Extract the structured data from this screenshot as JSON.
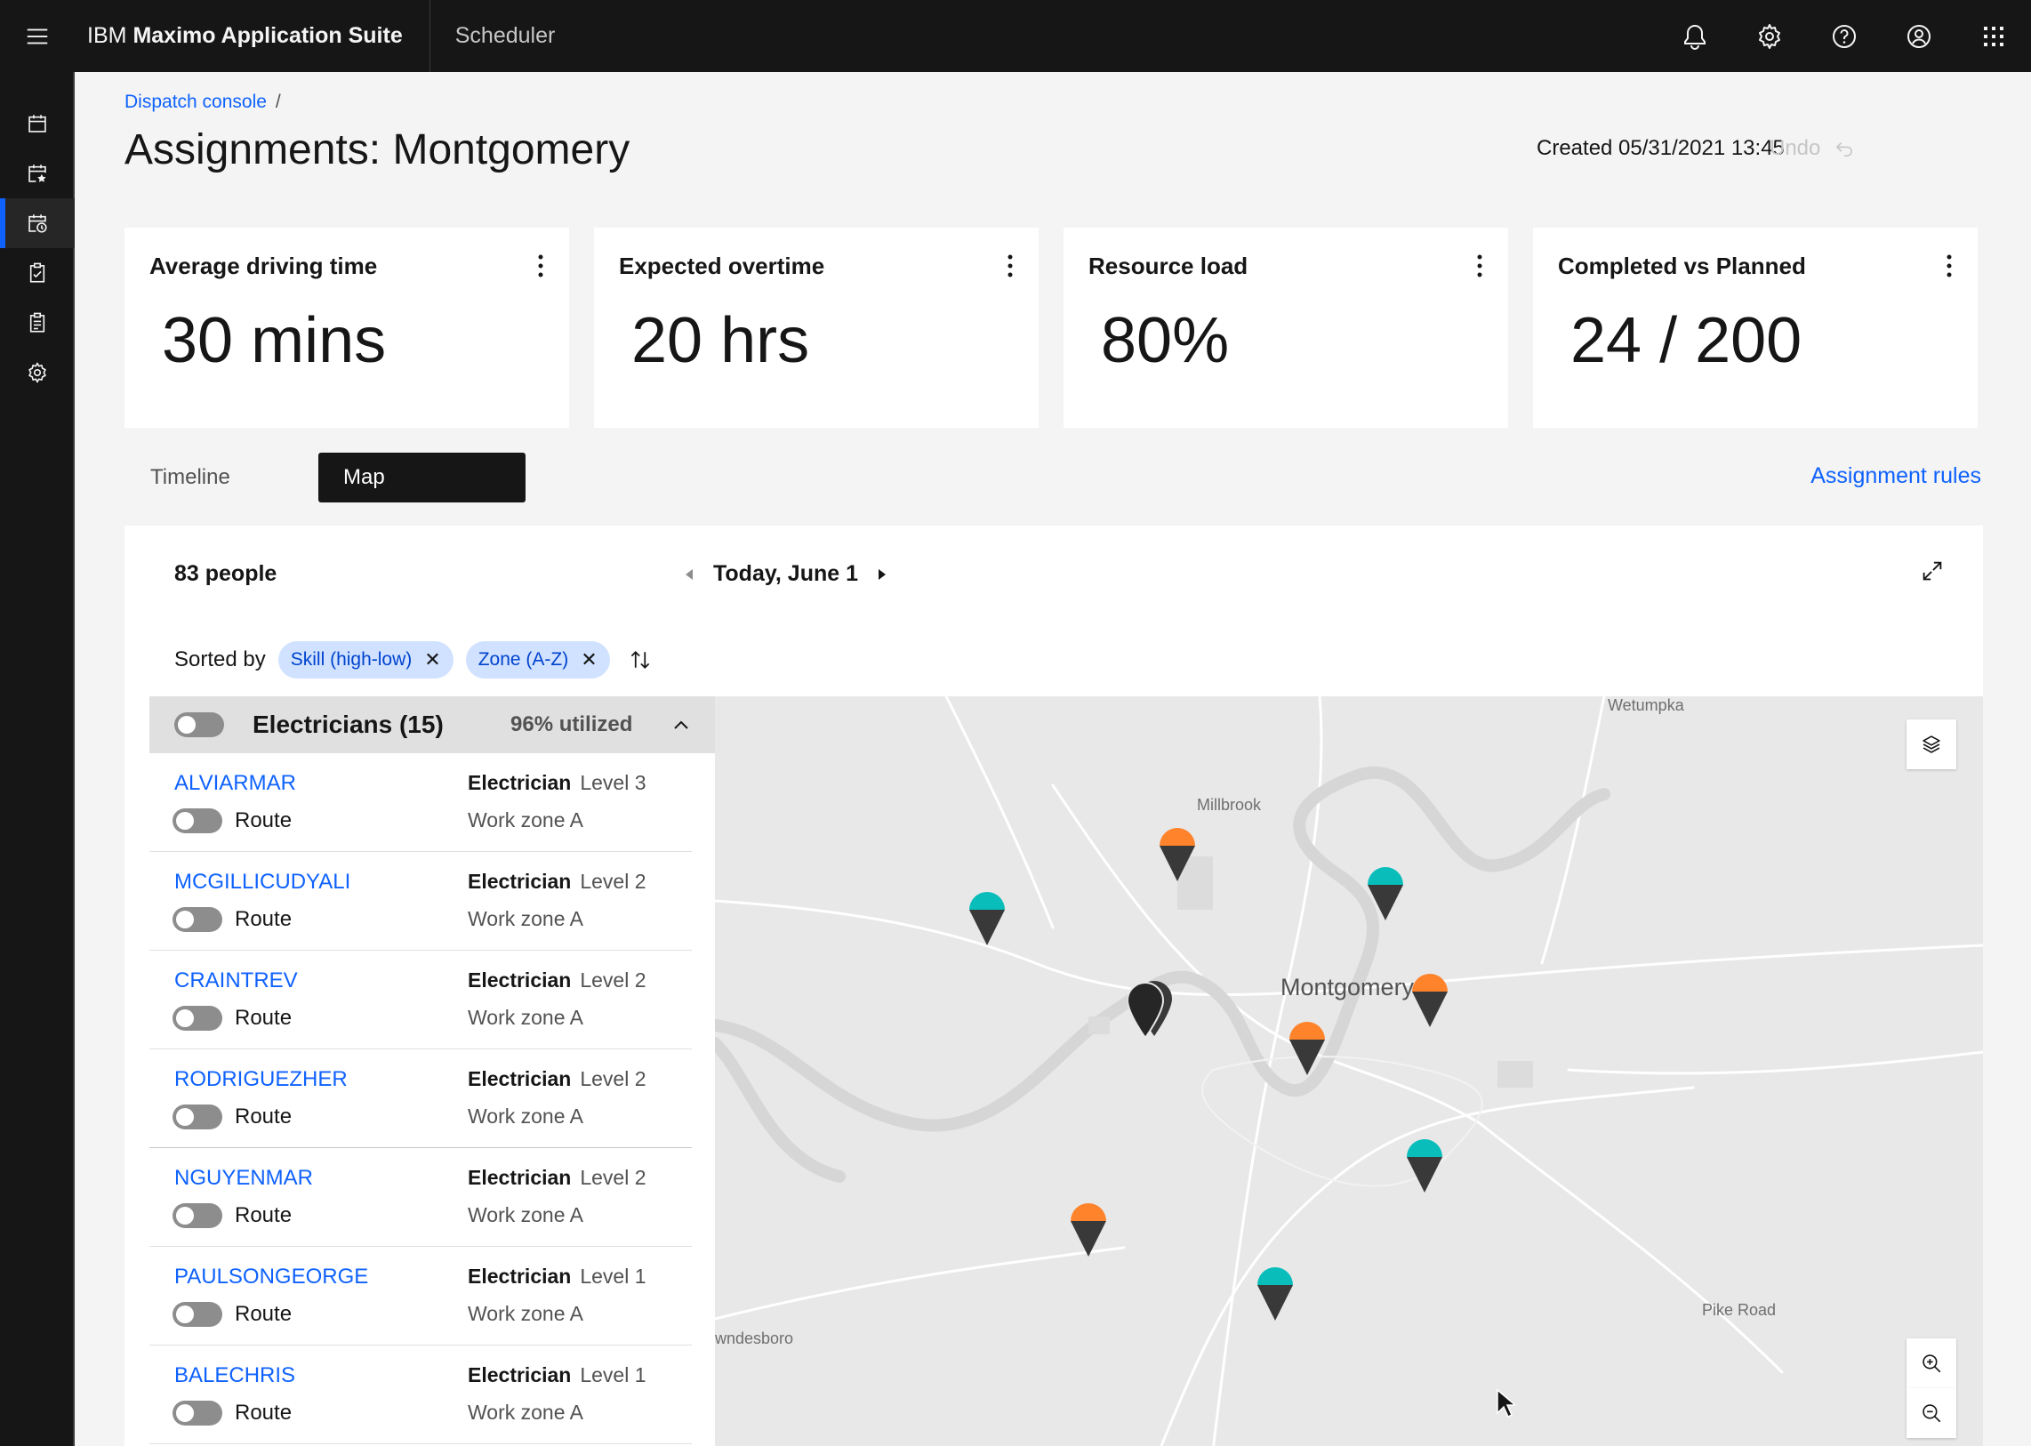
{
  "header": {
    "brand_prefix": "IBM",
    "brand_name": "Maximo Application Suite",
    "app_name": "Scheduler"
  },
  "breadcrumb": {
    "link": "Dispatch console",
    "separator": "/"
  },
  "page": {
    "title": "Assignments: Montgomery",
    "created": "Created 05/31/2021 13:45",
    "undo": "Undo"
  },
  "cards": [
    {
      "title": "Average driving time",
      "value": "30 mins"
    },
    {
      "title": "Expected overtime",
      "value": "20 hrs"
    },
    {
      "title": "Resource load",
      "value": "80%"
    },
    {
      "title": "Completed vs Planned",
      "value": "24 / 200"
    }
  ],
  "tabs": {
    "timeline": "Timeline",
    "map": "Map",
    "active": "Map"
  },
  "assignment_rules": "Assignment rules",
  "panel": {
    "people_count": "83 people",
    "date": "Today, June 1",
    "sorted_by": "Sorted by",
    "sort_tags": [
      "Skill (high-low)",
      "Zone (A-Z)"
    ]
  },
  "group": {
    "title": "Electricians (15)",
    "utilization": "96% utilized"
  },
  "people": [
    {
      "name": "ALVIARMAR",
      "role": "Electrician",
      "level": "Level 3",
      "route": "Route",
      "zone": "Work zone A"
    },
    {
      "name": "MCGILLICUDYALI",
      "role": "Electrician",
      "level": "Level 2",
      "route": "Route",
      "zone": "Work zone A"
    },
    {
      "name": "CRAINTREV",
      "role": "Electrician",
      "level": "Level 2",
      "route": "Route",
      "zone": "Work zone A"
    },
    {
      "name": "RODRIGUEZHER",
      "role": "Electrician",
      "level": "Level 2",
      "route": "Route",
      "zone": "Work zone A"
    },
    {
      "name": "NGUYENMAR",
      "role": "Electrician",
      "level": "Level 2",
      "route": "Route",
      "zone": "Work zone A"
    },
    {
      "name": "PAULSONGEORGE",
      "role": "Electrician",
      "level": "Level 1",
      "route": "Route",
      "zone": "Work zone A"
    },
    {
      "name": "BALECHRIS",
      "role": "Electrician",
      "level": "Level 1",
      "route": "Route",
      "zone": "Work zone A"
    }
  ],
  "map": {
    "labels": {
      "wetumpka": "Wetumpka",
      "millbrook": "Millbrook",
      "montgomery": "Montgomery",
      "pike_road": "Pike Road",
      "lowndesboro": "wndesboro"
    },
    "colors": {
      "orange": "#ff832b",
      "teal": "#08bdba",
      "dark": "#393939"
    }
  }
}
